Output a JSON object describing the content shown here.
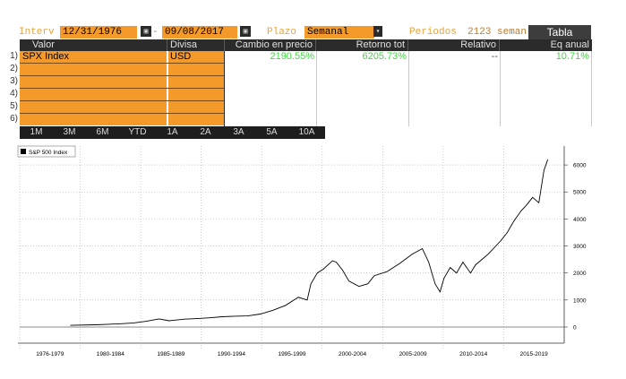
{
  "header": {
    "interval_label": "Interv",
    "start_date": "12/31/1976",
    "date_separator": "-",
    "end_date": "09/08/2017",
    "plazo_label": "Plazo",
    "plazo_value": "Semanal",
    "periods_label": "Periodos",
    "periods_value": "2123 seman...",
    "table_button": "Tabla"
  },
  "table": {
    "columns": [
      "Valor",
      "Divisa",
      "Cambio en precio",
      "Retorno tot",
      "Relativo",
      "Eq anual"
    ],
    "rows": [
      {
        "num": "1)",
        "valor": "SPX Index",
        "divisa": "USD",
        "cambio": "2190.55%",
        "retorno": "6205.73%",
        "relativo": "--",
        "eq": "10.71%"
      },
      {
        "num": "2)",
        "valor": "",
        "divisa": "",
        "cambio": "",
        "retorno": "",
        "relativo": "",
        "eq": ""
      },
      {
        "num": "3)",
        "valor": "",
        "divisa": "",
        "cambio": "",
        "retorno": "",
        "relativo": "",
        "eq": ""
      },
      {
        "num": "4)",
        "valor": "",
        "divisa": "",
        "cambio": "",
        "retorno": "",
        "relativo": "",
        "eq": ""
      },
      {
        "num": "5)",
        "valor": "",
        "divisa": "",
        "cambio": "",
        "retorno": "",
        "relativo": "",
        "eq": ""
      },
      {
        "num": "6)",
        "valor": "",
        "divisa": "",
        "cambio": "",
        "retorno": "",
        "relativo": "",
        "eq": ""
      }
    ]
  },
  "period_tabs": [
    "1M",
    "3M",
    "6M",
    "YTD",
    "1A",
    "2A",
    "3A",
    "5A",
    "10A"
  ],
  "colors": {
    "accent_orange": "#f39a2a",
    "positive_green": "#3ddc3d",
    "line": "#000000"
  },
  "chart_data": {
    "type": "line",
    "title": "",
    "xlabel": "",
    "ylabel": "",
    "legend": [
      "S&P 500 Index"
    ],
    "legend_position": "top-left",
    "x_tick_labels": [
      "1976-1979",
      "1980-1984",
      "1985-1989",
      "1990-1994",
      "1995-1999",
      "2000-2004",
      "2005-2009",
      "2010-2014",
      "2015-2019"
    ],
    "y_ticks": [
      0,
      1000,
      2000,
      3000,
      4000,
      5000,
      6000
    ],
    "ylim": [
      -400,
      6700
    ],
    "xlim": [
      1976,
      2019
    ],
    "grid": true,
    "series": [
      {
        "name": "S&P 500 Index",
        "x": [
          1980.0,
          1982.0,
          1983.0,
          1984.0,
          1985.0,
          1986.0,
          1987.0,
          1987.8,
          1988.0,
          1989.0,
          1990.0,
          1991.0,
          1992.0,
          1993.0,
          1994.0,
          1995.0,
          1996.0,
          1997.0,
          1998.0,
          1998.7,
          1999.0,
          1999.5,
          2000.0,
          2000.7,
          2001.0,
          2001.5,
          2002.0,
          2002.8,
          2003.5,
          2004.0,
          2005.0,
          2006.0,
          2007.0,
          2007.8,
          2008.3,
          2008.8,
          2009.2,
          2009.5,
          2010.0,
          2010.5,
          2011.0,
          2011.6,
          2012.0,
          2013.0,
          2014.0,
          2014.5,
          2015.0,
          2015.6,
          2016.0,
          2016.5,
          2017.0,
          2017.4,
          2017.7
        ],
        "y": [
          60,
          80,
          100,
          120,
          150,
          210,
          300,
          230,
          240,
          290,
          310,
          340,
          380,
          400,
          410,
          480,
          620,
          800,
          1100,
          1000,
          1600,
          2000,
          2150,
          2450,
          2400,
          2100,
          1700,
          1500,
          1600,
          1900,
          2050,
          2350,
          2700,
          2900,
          2400,
          1600,
          1300,
          1800,
          2200,
          2000,
          2400,
          2000,
          2300,
          2700,
          3200,
          3500,
          3900,
          4300,
          4500,
          4800,
          4600,
          5800,
          6200
        ]
      }
    ]
  }
}
